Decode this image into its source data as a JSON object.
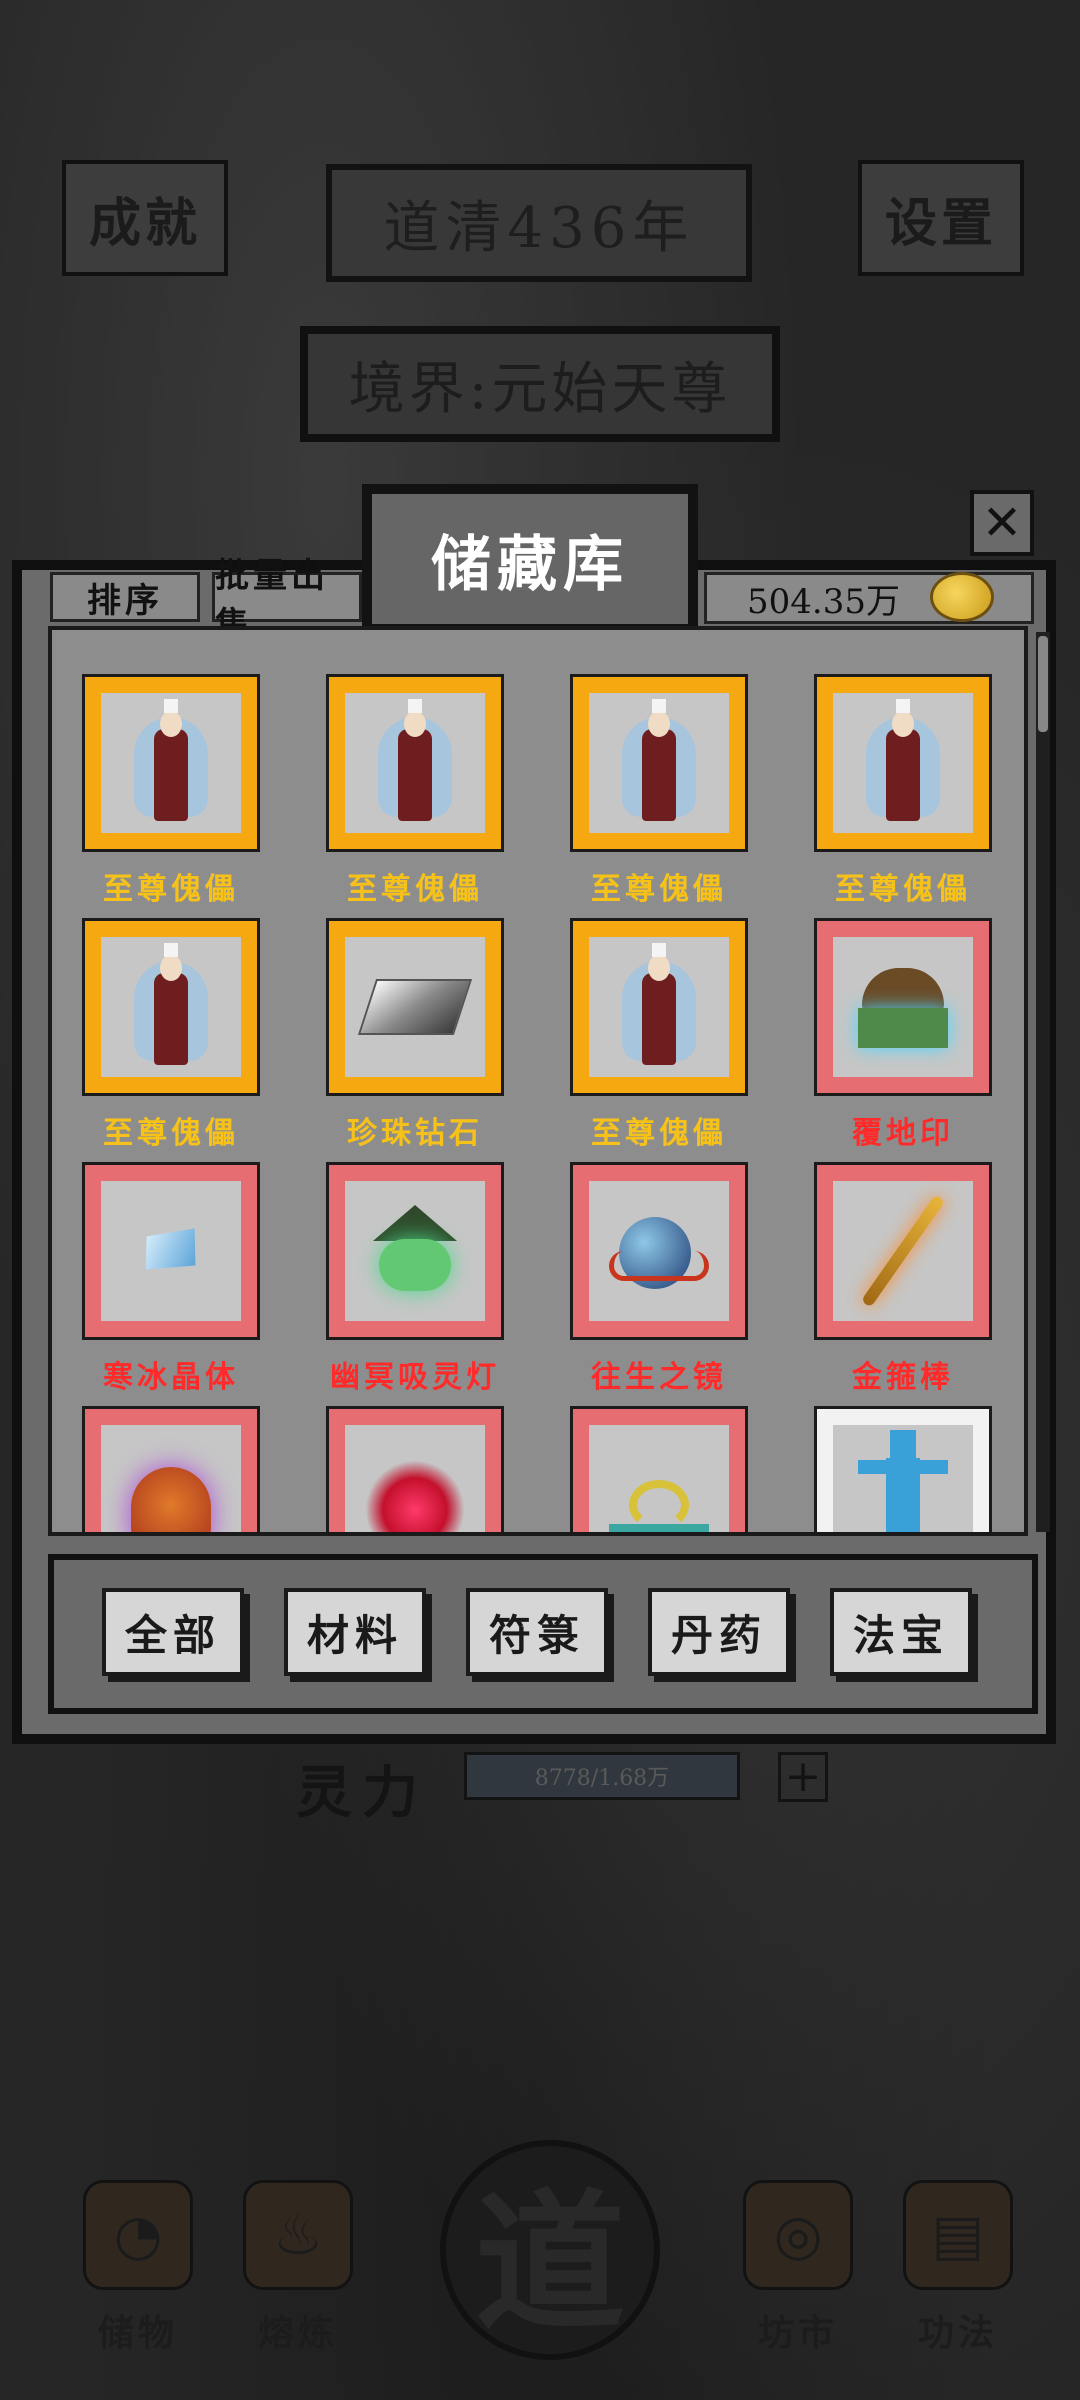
{
  "header": {
    "achievements_label": "成就",
    "year_label": "道清436年",
    "settings_label": "设置",
    "realm_label": "境界:元始天尊"
  },
  "storage": {
    "title": "储藏库",
    "close_glyph": "✕",
    "sort_label": "排序",
    "batch_sell_label": "批量出售",
    "currency_amount": "504.35万",
    "items": [
      {
        "name": "至尊傀儡",
        "rarity": "gold",
        "icon": "puppet-icon"
      },
      {
        "name": "至尊傀儡",
        "rarity": "gold",
        "icon": "puppet-icon"
      },
      {
        "name": "至尊傀儡",
        "rarity": "gold",
        "icon": "puppet-icon"
      },
      {
        "name": "至尊傀儡",
        "rarity": "gold",
        "icon": "puppet-icon"
      },
      {
        "name": "至尊傀儡",
        "rarity": "gold",
        "icon": "puppet-icon"
      },
      {
        "name": "珍珠钻石",
        "rarity": "gold",
        "icon": "diamond-icon"
      },
      {
        "name": "至尊傀儡",
        "rarity": "gold",
        "icon": "puppet-icon"
      },
      {
        "name": "覆地印",
        "rarity": "red",
        "icon": "turtle-seal-icon"
      },
      {
        "name": "寒冰晶体",
        "rarity": "red",
        "icon": "ice-crystal-icon"
      },
      {
        "name": "幽冥吸灵灯",
        "rarity": "red",
        "icon": "ghost-lamp-icon"
      },
      {
        "name": "往生之镜",
        "rarity": "red",
        "icon": "mirror-icon"
      },
      {
        "name": "金箍棒",
        "rarity": "red",
        "icon": "golden-staff-icon"
      },
      {
        "name": "",
        "rarity": "red",
        "icon": "mask-icon"
      },
      {
        "name": "",
        "rarity": "red",
        "icon": "red-flower-icon"
      },
      {
        "name": "",
        "rarity": "red",
        "icon": "dragon-icon"
      },
      {
        "name": "",
        "rarity": "blue",
        "icon": "statue-icon"
      }
    ],
    "tabs": [
      {
        "label": "全部"
      },
      {
        "label": "材料"
      },
      {
        "label": "符箓"
      },
      {
        "label": "丹药"
      },
      {
        "label": "法宝"
      }
    ]
  },
  "lingli": {
    "label": "灵力",
    "value": "8778/1.68万",
    "plus_glyph": "+"
  },
  "nav": {
    "storage_label": "储物",
    "smelt_label": "熔炼",
    "center_glyph": "道",
    "market_label": "坊市",
    "skill_label": "功法"
  },
  "colors": {
    "gold_frame": "#f5a810",
    "red_frame": "#e66e72",
    "gold_text": "#f6c21a",
    "red_text": "#ff2a2a"
  }
}
